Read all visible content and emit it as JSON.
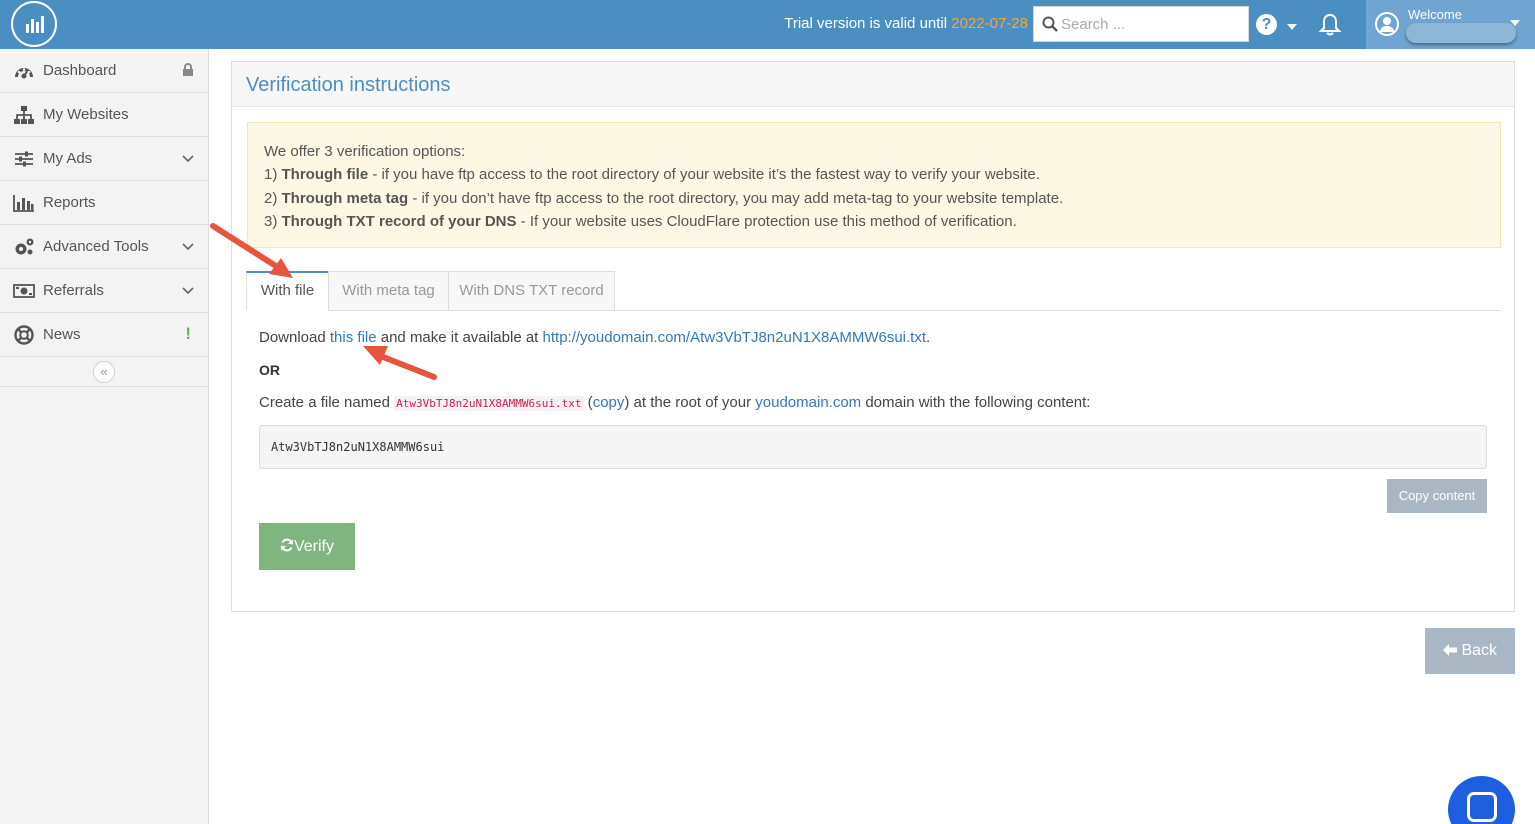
{
  "header": {
    "trial_text": "Trial version is valid until",
    "trial_date": "2022-07-28",
    "search_placeholder": "Search ...",
    "help_label": "?",
    "welcome_label": "Welcome"
  },
  "sidebar": {
    "items": [
      {
        "label": "Dashboard",
        "icon": "dashboard-icon",
        "suffix": "lock-icon"
      },
      {
        "label": "My Websites",
        "icon": "sitemap-icon"
      },
      {
        "label": "My Ads",
        "icon": "sliders-icon",
        "suffix": "chevron-down-icon"
      },
      {
        "label": "Reports",
        "icon": "bar-chart-icon"
      },
      {
        "label": "Advanced Tools",
        "icon": "gears-icon",
        "suffix": "chevron-down-icon"
      },
      {
        "label": "Referrals",
        "icon": "money-icon",
        "suffix": "chevron-down-icon"
      },
      {
        "label": "News",
        "icon": "lifebuoy-icon",
        "suffix": "exclamation-icon"
      }
    ],
    "collapse_label": "«",
    "news_badge": "!"
  },
  "main": {
    "title": "Verification instructions",
    "notice": {
      "intro": "We offer 3 verification options:",
      "opt1_num": "1)",
      "opt1_bold": "Through file",
      "opt1_text": " - if you have ftp access to the root directory of your website it’s the fastest way to verify your website.",
      "opt2_num": "2)",
      "opt2_bold": "Through meta tag",
      "opt2_text": " - if you don’t have ftp access to the root directory, you may add meta-tag to your website template.",
      "opt3_num": "3)",
      "opt3_bold": "Through TXT record of your DNS",
      "opt3_text": " - If your website uses CloudFlare protection use this method of verification."
    },
    "tabs": [
      {
        "label": "With file",
        "active": true
      },
      {
        "label": "With meta tag",
        "active": false
      },
      {
        "label": "With DNS TXT record",
        "active": false
      }
    ],
    "download": {
      "prefix": "Download ",
      "link_text": "this file",
      "middle": " and make it available at ",
      "url": "http://youdomain.com/Atw3VbTJ8n2uN1X8AMMW6sui.txt",
      "suffix": "."
    },
    "or_label": "OR",
    "create": {
      "prefix": "Create a file named ",
      "filename": "Atw3VbTJ8n2uN1X8AMMW6sui.txt",
      "copy_open": " (",
      "copy_link": "copy",
      "copy_close": ") at the root of your ",
      "domain": "youdomain.com",
      "suffix": " domain with the following content:"
    },
    "file_content": "Atw3VbTJ8n2uN1X8AMMW6sui",
    "copy_button": "Copy content",
    "verify_button": "Verify",
    "back_button": "Back"
  },
  "colors": {
    "header_bg": "#4b8fc2",
    "accent_date": "#f3a735",
    "verify_green": "#7fb67f",
    "link_blue": "#3478b8",
    "annotation_arrow": "#e8553f"
  }
}
